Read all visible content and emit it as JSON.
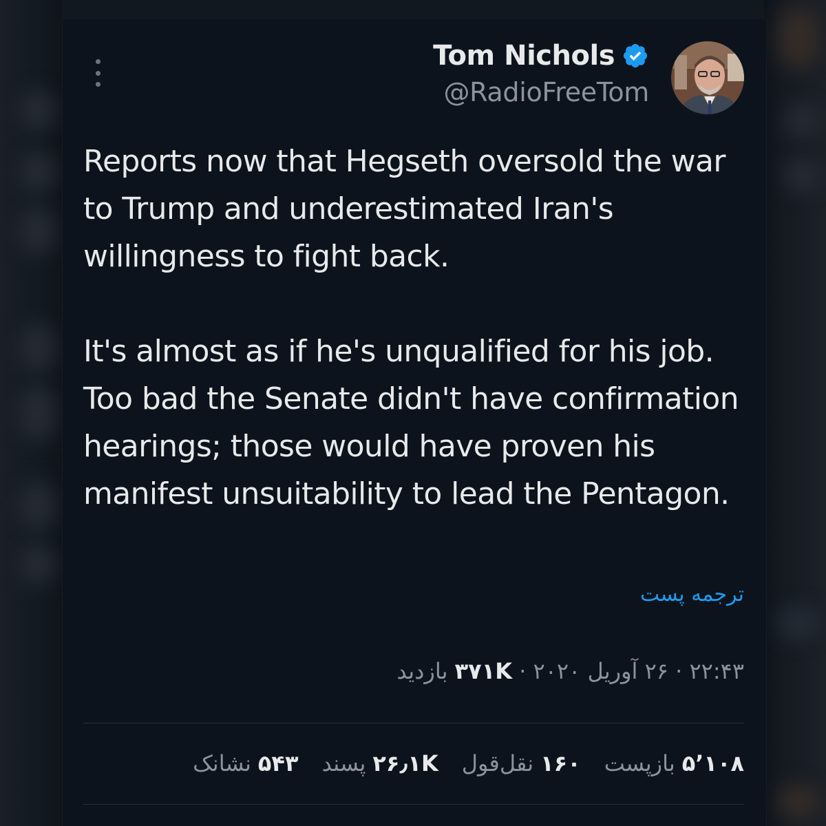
{
  "author": {
    "display_name": "Tom Nichols",
    "handle": "@RadioFreeTom",
    "verified": true,
    "verified_color": "#1d9bf0"
  },
  "tweet": {
    "paragraphs": [
      "Reports now that Hegseth oversold the war to Trump and underestimated Iran's willingness to fight back.",
      "It's almost as if he's unqualified for his job. Too bad the Senate didn't have confirmation hearings; those would have proven his manifest unsuitability to lead the Pentagon."
    ],
    "translate_label": "ترجمه پست",
    "time": "۲۲:۴۳",
    "date": "۲۶ آوریل ۲۰۲۰",
    "separator": "·",
    "views_count": "۳۷۱K",
    "views_label": "بازدید"
  },
  "stats": [
    {
      "count": "۵٬۱۰۸",
      "label": "بازپست"
    },
    {
      "count": "۱۶۰",
      "label": "نقل‌قول"
    },
    {
      "count": "۲۶٫۱K",
      "label": "پسند"
    },
    {
      "count": "۵۴۳",
      "label": "نشانک"
    }
  ],
  "icons": {
    "more": "more-vertical-icon",
    "verified": "verified-badge-icon"
  },
  "colors": {
    "background": "#0d131c",
    "text": "#e7e9ea",
    "secondary": "#8b949e",
    "link": "#1d9bf0"
  }
}
